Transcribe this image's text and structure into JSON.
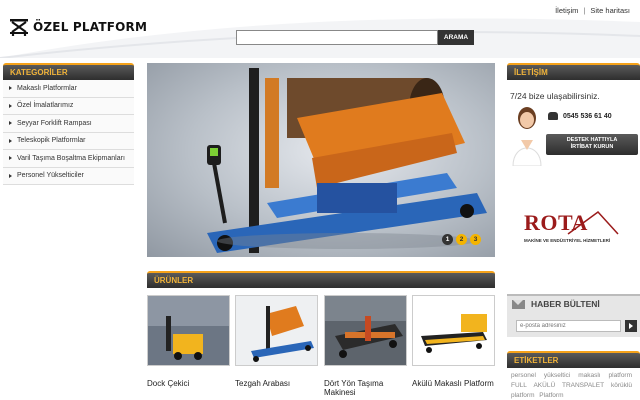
{
  "header": {
    "logo_text": "ÖZEL PLATFORM",
    "links": [
      "İletişim",
      "Site haritası"
    ],
    "link_separator": "|"
  },
  "search": {
    "placeholder": "",
    "button_label": "ARAMA"
  },
  "sidebar": {
    "title": "KATEGORİLER",
    "items": [
      {
        "label": "Makaslı Platformlar"
      },
      {
        "label": "Özel İmalatlarımız"
      },
      {
        "label": "Seyyar Forklift Rampası"
      },
      {
        "label": "Teleskopik Platformlar"
      },
      {
        "label": "Varil Taşıma Boşaltma Ekipmanları"
      },
      {
        "label": "Personel Yükselticiler"
      }
    ]
  },
  "slider": {
    "dots": [
      "1",
      "2",
      "3"
    ],
    "active_dots": [
      2,
      3
    ]
  },
  "products": {
    "title": "ÜRÜNLER",
    "items": [
      {
        "name": "Dock Çekici"
      },
      {
        "name": "Tezgah Arabası"
      },
      {
        "name": "Dört Yön Taşıma Makinesi"
      },
      {
        "name": "Akülü Makaslı Platform"
      }
    ]
  },
  "contact": {
    "title": "İLETİŞİM",
    "availability": "7/24 bize ulaşabilirsiniz.",
    "phone": "0545 536 61 40",
    "hotline_line1": "DESTEK HATTIYLA",
    "hotline_line2": "İRTİBAT KURUN"
  },
  "partner": {
    "name": "ROTA",
    "subtitle": "MAKİNE VE ENDÜSTRİYEL HİZMETLERİ"
  },
  "newsletter": {
    "title": "HABER BÜLTENİ",
    "placeholder": "e-posta adresiniz"
  },
  "tags": {
    "title": "ETİKETLER",
    "items": [
      "personel",
      "yükseltici",
      "makaslı",
      "platform",
      "FULL",
      "AKÜLÜ",
      "TRANSPALET",
      "körüklü",
      "platform",
      "Platform"
    ]
  },
  "colors": {
    "accent": "#f5a21a",
    "header_dark": "#333333",
    "brand_red": "#9b1b1b"
  }
}
